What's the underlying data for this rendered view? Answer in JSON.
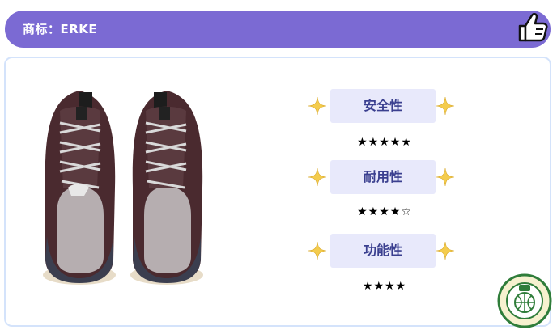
{
  "header": {
    "brand_label": "商标：ERKE",
    "like_icon": "thumbs-up-icon"
  },
  "product": {
    "image": "pair-of-sneakers-front-view"
  },
  "ratings": [
    {
      "label": "安全性",
      "stars_text": "★★★★★",
      "rating": 5
    },
    {
      "label": "耐用性",
      "stars_text": "★★★★☆",
      "rating": 4.5
    },
    {
      "label": "功能性",
      "stars_text": "★★★★",
      "rating": 4
    }
  ],
  "colors": {
    "header_bg": "#7b6ad3",
    "label_bg": "#e8e9fb",
    "label_text": "#3a3f8f",
    "sparkle": "#f4cc4d",
    "card_border": "#d4e3fb"
  },
  "seal": {
    "icon": "certification-seal-icon"
  }
}
